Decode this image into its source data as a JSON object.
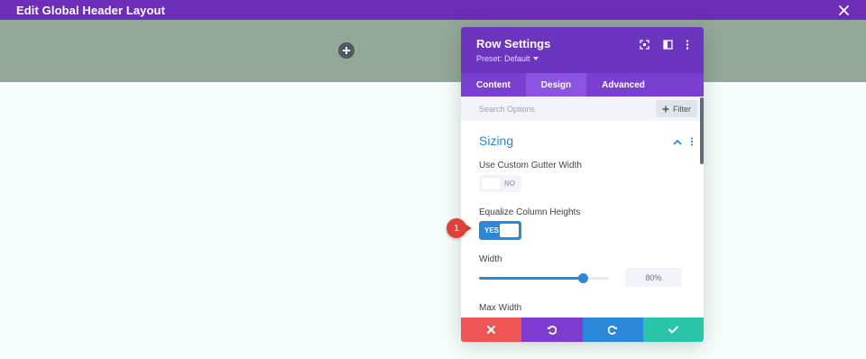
{
  "topbar": {
    "title": "Edit Global Header Layout"
  },
  "modal": {
    "title": "Row Settings",
    "preset": "Preset: Default",
    "tabs": [
      {
        "label": "Content"
      },
      {
        "label": "Design"
      },
      {
        "label": "Advanced"
      }
    ],
    "active_tab": "Design",
    "search": {
      "placeholder": "Search Options",
      "filter_label": "Filter"
    },
    "section": {
      "title": "Sizing"
    },
    "fields": {
      "gutter": {
        "label": "Use Custom Gutter Width",
        "value": "NO"
      },
      "equalize": {
        "label": "Equalize Column Heights",
        "value": "YES"
      },
      "width": {
        "label": "Width",
        "value": "80%",
        "slider_fraction": 0.8
      },
      "max_width": {
        "label": "Max Width"
      }
    }
  },
  "annotation": {
    "number": "1"
  },
  "colors": {
    "topbar": "#6c2eb9",
    "modal_header": "#6b35bf",
    "tabs_bar": "#7a3fd0",
    "accent_blue": "#2b87da",
    "discard": "#ef5555",
    "undo": "#7e3bd0",
    "redo": "#2b87da",
    "save": "#29c4a9",
    "badge": "#e0403a"
  },
  "icons": {
    "close": "close-icon",
    "add": "plus-icon",
    "expand": "expand-icon",
    "sidebar": "columns-icon",
    "more": "more-vertical-icon",
    "collapse": "chevron-up-icon",
    "discard": "x-icon",
    "undo": "undo-icon",
    "redo": "redo-icon",
    "save": "check-icon"
  }
}
